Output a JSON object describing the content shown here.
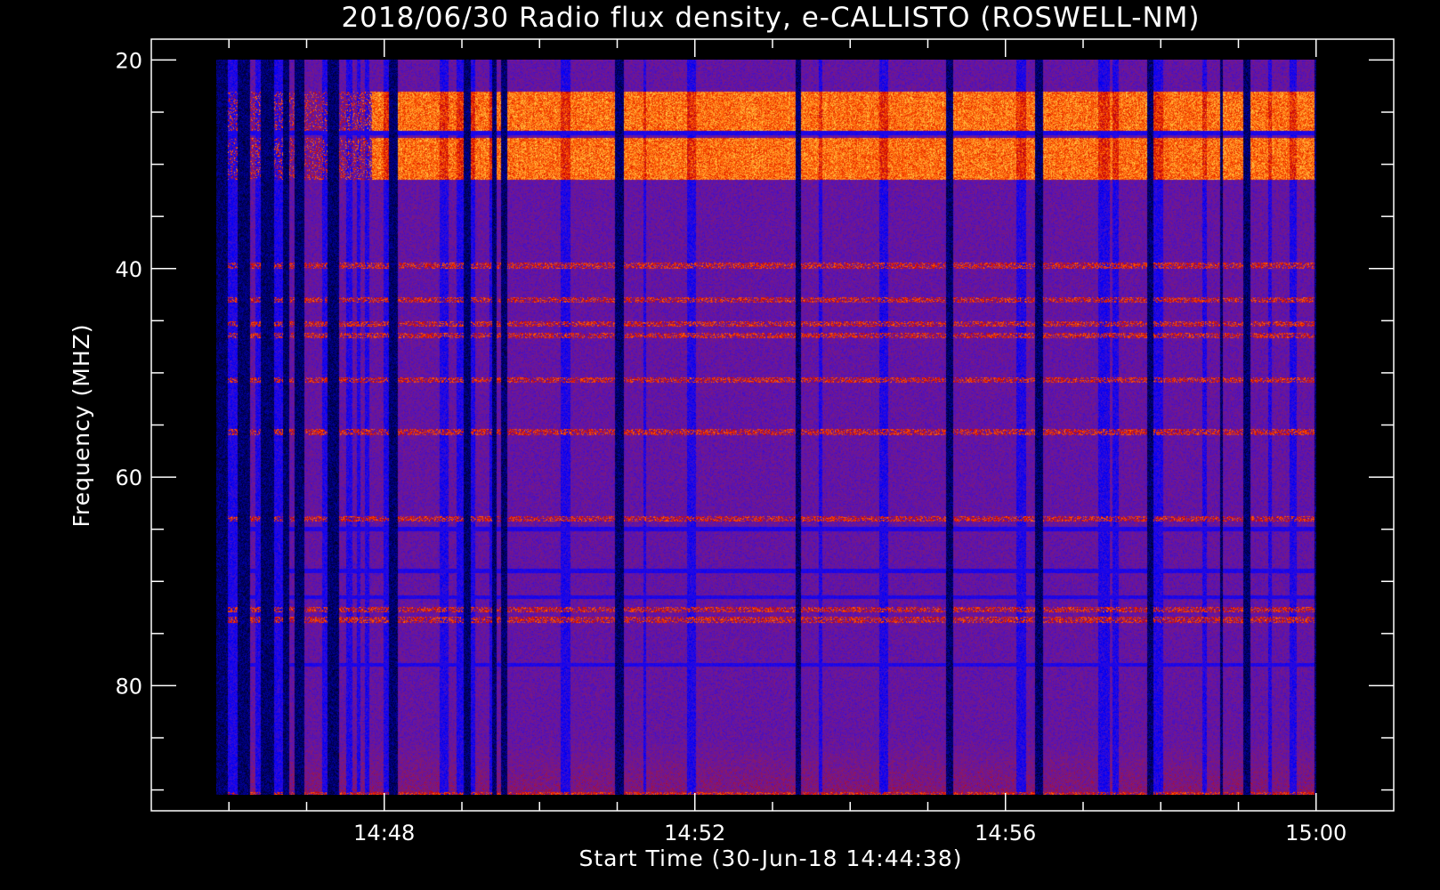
{
  "chart_data": {
    "type": "heatmap",
    "title": "2018/06/30  Radio flux density, e-CALLISTO (ROSWELL-NM)",
    "xlabel": "Start Time (30-Jun-18 14:44:38)",
    "ylabel": "Frequency (MHZ)",
    "x_range_minutes": [
      "14:45:50",
      "15:00:00"
    ],
    "x_axis_range": [
      "14:45:00",
      "15:01:00"
    ],
    "x_ticks": [
      "14:48",
      "14:52",
      "14:56",
      "15:00"
    ],
    "y_axis_range_mhz": [
      18,
      92
    ],
    "y_data_range_mhz": [
      20,
      90.5
    ],
    "y_ticks": [
      20,
      40,
      60,
      80
    ],
    "y_inverted": true,
    "colormap": [
      "#000000",
      "#0000ff",
      "#5a14b4",
      "#8a1a66",
      "#cc0000",
      "#ff5500",
      "#ffaa33",
      "#ffff66"
    ],
    "colorbar": false,
    "grid": false,
    "features": {
      "bright_bands_mhz": [
        [
          23.0,
          26.8
        ],
        [
          27.5,
          31.5
        ]
      ],
      "bright_bands_time": [
        "14:47:50",
        "15:00:00"
      ],
      "narrow_lines_mhz": [
        39.7,
        43.0,
        45.3,
        46.4,
        50.7,
        55.7,
        64.0,
        72.7,
        73.7,
        90.5
      ],
      "dim_lines_mhz": [
        27.0,
        65.0,
        69.0,
        71.5,
        78.0
      ]
    }
  }
}
